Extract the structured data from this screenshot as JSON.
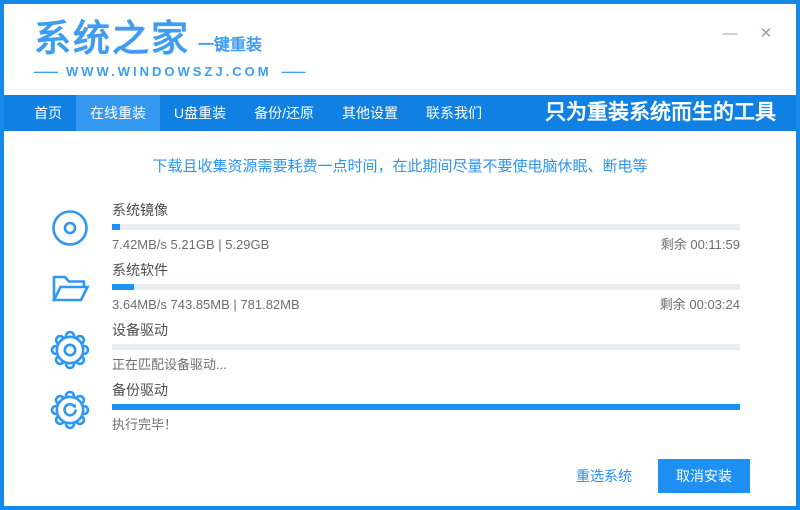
{
  "window_controls": {
    "minimize_icon": "—",
    "close_icon": "✕"
  },
  "header": {
    "logo_title": "系统之家",
    "logo_subtitle": "一键重装",
    "dash_left": "——",
    "logo_url": "WWW.WINDOWSZJ.COM",
    "dash_right": "——"
  },
  "nav": {
    "items": [
      {
        "label": "首页",
        "active": false
      },
      {
        "label": "在线重装",
        "active": true
      },
      {
        "label": "U盘重装",
        "active": false
      },
      {
        "label": "备份/还原",
        "active": false
      },
      {
        "label": "其他设置",
        "active": false
      },
      {
        "label": "联系我们",
        "active": false
      }
    ],
    "slogan": "只为重装系统而生的工具"
  },
  "notice": "下载且收集资源需要耗费一点时间，在此期间尽量不要使电脑休眠、断电等",
  "tasks": [
    {
      "icon": "disc-icon",
      "label": "系统镜像",
      "progress_percent": 1.3,
      "status_left": "7.42MB/s 5.21GB | 5.29GB",
      "status_right": "剩余 00:11:59"
    },
    {
      "icon": "folder-icon",
      "label": "系统软件",
      "progress_percent": 3.5,
      "status_left": "3.64MB/s 743.85MB | 781.82MB",
      "status_right": "剩余 00:03:24"
    },
    {
      "icon": "gear-icon",
      "label": "设备驱动",
      "progress_percent": 0,
      "status_left": "正在匹配设备驱动...",
      "status_right": ""
    },
    {
      "icon": "gear-sync-icon",
      "label": "备份驱动",
      "progress_percent": 100,
      "status_left": "执行完毕！",
      "status_right": ""
    }
  ],
  "footer": {
    "reselect_label": "重选系统",
    "cancel_label": "取消安装"
  },
  "colors": {
    "primary": "#1789E9",
    "nav_bg": "#1081E3",
    "active_tab": "#3598F0",
    "bar_fill": "#1E90F2",
    "bar_track": "#E8EDF4",
    "logo_blue": "#3E9CF3"
  }
}
